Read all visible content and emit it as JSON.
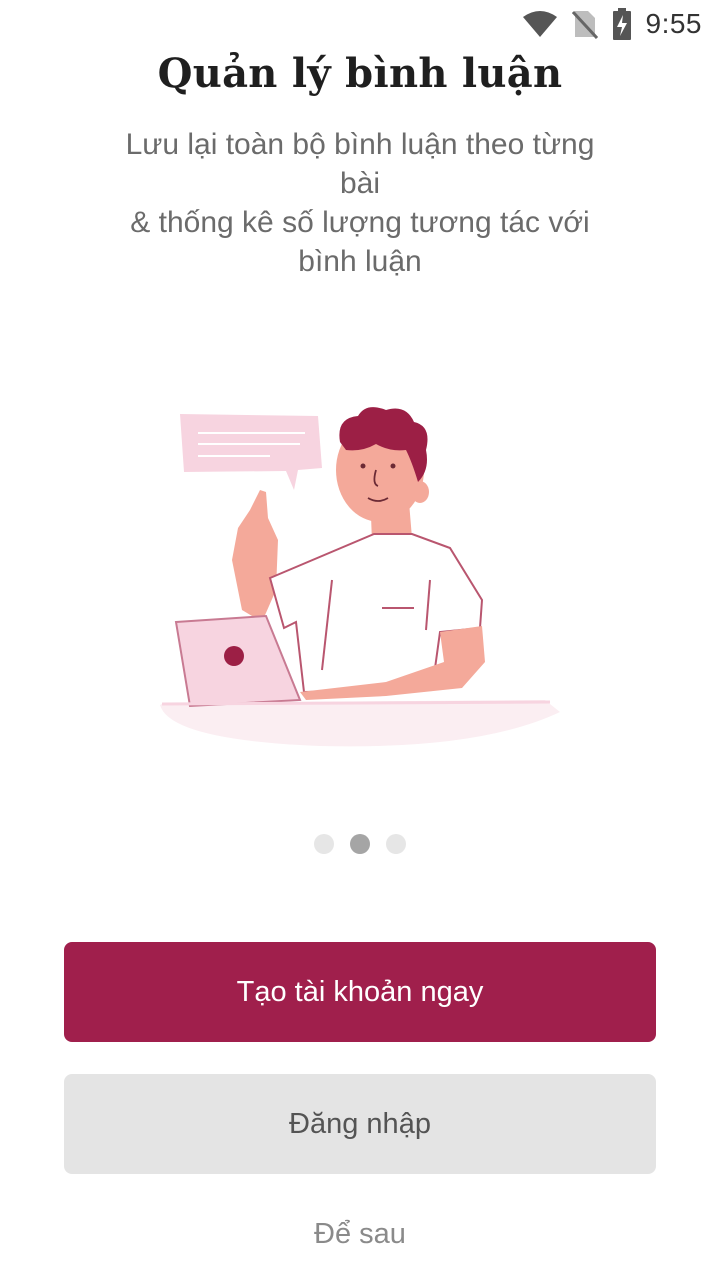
{
  "status_bar": {
    "time": "9:55",
    "icons": [
      "wifi-icon",
      "no-sim-icon",
      "battery-charging-icon"
    ]
  },
  "onboarding": {
    "title": "Quản lý bình luận",
    "subtitle_lines": [
      "Lưu lại toàn bộ bình luận theo từng",
      "bài",
      "& thống kê số lượng tương tác với",
      "bình luận"
    ],
    "illustration": "person-at-laptop-with-speech-bubble",
    "pager": {
      "count": 3,
      "active_index": 1
    }
  },
  "actions": {
    "create_account_label": "Tạo tài khoản ngay",
    "login_label": "Đăng nhập",
    "later_label": "Để sau"
  },
  "colors": {
    "primary": "#a01f4c",
    "secondary_bg": "#e4e4e4",
    "illustration_pink": "#f7d4e0",
    "skin": "#f4a99a",
    "hair": "#9c1f45"
  }
}
